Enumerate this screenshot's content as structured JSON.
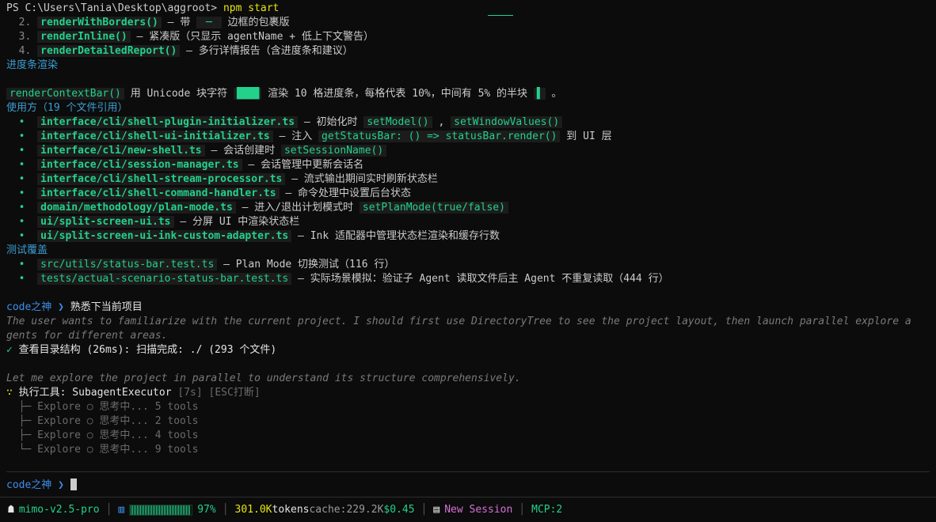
{
  "terminal": {
    "prompt_path": "PS C:\\Users\\Tania\\Desktop\\aggroot> ",
    "command": "npm start",
    "list_items": [
      {
        "num": "2.",
        "code": "renderWithBorders()",
        "sep": " — 带 ",
        "mid": " ─ ",
        "text": " 边框的包裹版"
      },
      {
        "num": "3.",
        "code": "renderInline()",
        "text": " — 紧凑版（只显示 agentName + 低上下文警告）"
      },
      {
        "num": "4.",
        "code": "renderDetailedReport()",
        "text": " — 多行详情报告（含进度条和建议）"
      }
    ],
    "section_progress": "进度条渲染",
    "progress_line": {
      "code": "renderContextBar()",
      "text1": " 用 Unicode 块字符 ",
      "block1": "████",
      "text2": " 渲染 10 格进度条，每格代表 10%，中间有 5% 的半块 ",
      "block2": "▌",
      "text3": " 。"
    },
    "section_usage": "使用方（19 个文件引用）",
    "usage_items": [
      {
        "file": "interface/cli/shell-plugin-initializer.ts",
        "text": " — 初始化时 ",
        "code1": "setModel()",
        "mid": " , ",
        "code2": "setWindowValues()"
      },
      {
        "file": "interface/cli/shell-ui-initializer.ts",
        "text": " — 注入 ",
        "code1": "getStatusBar: () => statusBar.render()",
        "mid": " 到 UI 层",
        "code2": ""
      },
      {
        "file": "interface/cli/new-shell.ts",
        "text": " — 会话创建时 ",
        "code1": "setSessionName()",
        "mid": "",
        "code2": ""
      },
      {
        "file": "interface/cli/session-manager.ts",
        "text": " — 会话管理中更新会话名",
        "code1": "",
        "mid": "",
        "code2": ""
      },
      {
        "file": "interface/cli/shell-stream-processor.ts",
        "text": " — 流式输出期间实时刷新状态栏",
        "code1": "",
        "mid": "",
        "code2": ""
      },
      {
        "file": "interface/cli/shell-command-handler.ts",
        "text": " — 命令处理中设置后台状态",
        "code1": "",
        "mid": "",
        "code2": ""
      },
      {
        "file": "domain/methodology/plan-mode.ts",
        "text": " — 进入/退出计划模式时 ",
        "code1": "setPlanMode(true/false)",
        "mid": "",
        "code2": ""
      },
      {
        "file": "ui/split-screen-ui.ts",
        "text": " — 分屏 UI 中渲染状态栏",
        "code1": "",
        "mid": "",
        "code2": ""
      },
      {
        "file": "ui/split-screen-ui-ink-custom-adapter.ts",
        "text": " — Ink 适配器中管理状态栏渲染和缓存行数",
        "code1": "",
        "mid": "",
        "code2": ""
      }
    ],
    "section_tests": "测试覆盖",
    "test_items": [
      {
        "file": "src/utils/status-bar.test.ts",
        "text": " — Plan Mode 切换测试（116 行）"
      },
      {
        "file": "tests/actual-scenario-status-bar.test.ts",
        "text": " — 实际场景模拟：验证子 Agent 读取文件后主 Agent 不重复读取（444 行）"
      }
    ],
    "user_prompt_name": "code之神",
    "user_prompt_arrow": " ❯ ",
    "user_message": "熟悉下当前项目",
    "thinking_line1": "The user wants to familiarize with the current project. I should first use DirectoryTree to see the project layout, then launch parallel explore a",
    "thinking_line2": "gents for different areas.",
    "check_mark": "✓",
    "tool_result": " 查看目录结构 (26ms): 扫描完成: ./ (293 个文件)",
    "explore_note": "Let me explore the project in parallel to understand its structure comprehensively.",
    "spinner": "∵",
    "exec_label": " 执行工具: SubagentExecutor",
    "exec_time": " [7s]",
    "exec_hint": " [ESC打断]",
    "explorers": [
      {
        "branch": "  ├─ ",
        "label": "Explore ○ 思考中... 5 tools"
      },
      {
        "branch": "  ├─ ",
        "label": "Explore ○ 思考中... 2 tools"
      },
      {
        "branch": "  ├─ ",
        "label": "Explore ○ 思考中... 4 tools"
      },
      {
        "branch": "  └─ ",
        "label": "Explore ○ 思考中... 9 tools"
      }
    ],
    "input_prompt_name": "code之神",
    "input_prompt_arrow": " ❯ "
  },
  "statusbar": {
    "model_icon": "robot-icon",
    "model": "mimo-v2.5-pro",
    "context_icon": "chart-icon",
    "context_percent": "97%",
    "context_fraction": 0.97,
    "tokens_value": "301.0K",
    "tokens_label": " tokens",
    "cache": " cache:229.2K",
    "cost": " $0.45",
    "session_icon": "chat-icon",
    "session": "New Session",
    "mcp": "MCP:2"
  },
  "colors": {
    "accent_green": "#23d18b",
    "accent_blue": "#3b8eea",
    "accent_yellow": "#e5e510",
    "accent_magenta": "#d670d6",
    "background": "#0c0c0c"
  }
}
